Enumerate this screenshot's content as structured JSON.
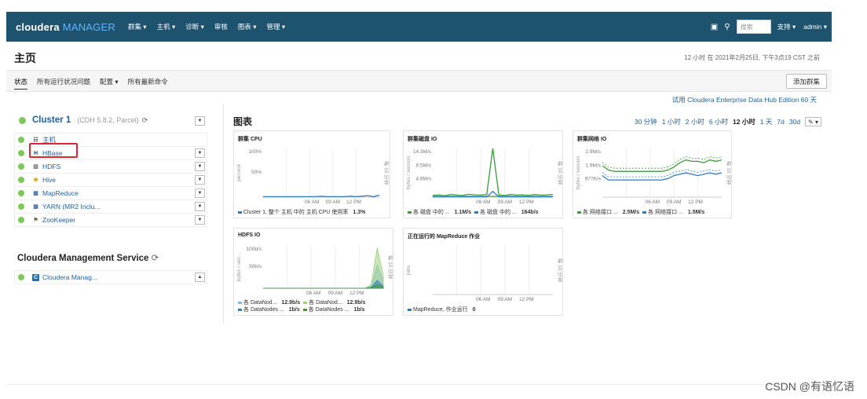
{
  "navbar": {
    "brand_main": "cloudera",
    "brand_sub": "MANAGER",
    "menu": [
      "群集 ▾",
      "主机 ▾",
      "诊断 ▾",
      "审核",
      "图表 ▾",
      "管理 ▾"
    ],
    "icons": [
      "briefcase-icon",
      "search-user-icon"
    ],
    "search_placeholder": "搜索",
    "support": "支持 ▾",
    "user": "admin ▾"
  },
  "page": {
    "title": "主页",
    "timestamp": "12 小时 在 2021年2月25日, 下午3点19 CST 之前"
  },
  "subnav": {
    "tabs": [
      "状态",
      "所有运行状况问题",
      "配置 ▾",
      "所有最新命令"
    ],
    "add_cluster": "添加群集"
  },
  "trial": "试用 Cloudera Enterprise Data Hub Edition 60 天",
  "cluster": {
    "name": "Cluster 1",
    "version": "(CDH 5.8.2, Parcel)",
    "status_color": "#7cc95a",
    "services": [
      {
        "name": "主机",
        "icon": "hosts-icon",
        "dropdown": false
      },
      {
        "name": "HBase",
        "icon": "hbase-icon",
        "dropdown": true
      },
      {
        "name": "HDFS",
        "icon": "hdfs-icon",
        "dropdown": true
      },
      {
        "name": "Hive",
        "icon": "hive-icon",
        "dropdown": true
      },
      {
        "name": "MapReduce",
        "icon": "mapreduce-icon",
        "dropdown": true
      },
      {
        "name": "YARN (MR2 Inclu...",
        "icon": "yarn-icon",
        "dropdown": true
      },
      {
        "name": "ZooKeeper",
        "icon": "zookeeper-icon",
        "dropdown": true
      }
    ]
  },
  "mgmt": {
    "title": "Cloudera Management Service",
    "service": "Cloudera Manag..."
  },
  "charts": {
    "title": "图表",
    "ranges": [
      "30 分钟",
      "1 小时",
      "2 小时",
      "6 小时",
      "12 小时",
      "1 天",
      "7d",
      "30d"
    ],
    "selected_range": "12 小时",
    "edit_icon": "edit-icon"
  },
  "chart_data": [
    {
      "type": "line",
      "title": "群集 CPU",
      "ylabel": "percent",
      "yticks": [
        "100%",
        "50%"
      ],
      "xticks": [
        "06 AM",
        "09 AM",
        "12 PM"
      ],
      "right_label": "每 10 分钟",
      "ylim": [
        0,
        100
      ],
      "series": [
        {
          "name": "Cluster 1, 整个 主机 中的 主机 CPU 使用率",
          "value": "1.3%",
          "color": "#2f7bbf",
          "values": [
            1,
            1,
            1,
            1,
            1,
            1,
            1,
            1,
            1,
            1,
            2,
            1,
            1,
            1,
            1,
            2,
            1,
            2,
            3,
            1,
            4
          ]
        }
      ]
    },
    {
      "type": "line",
      "title": "群集磁盘 IO",
      "ylabel": "bytes / second",
      "yticks": [
        "14.3M/s",
        "9.5M/s",
        "4.8M/s"
      ],
      "xticks": [
        "06 AM",
        "09 AM",
        "12 PM"
      ],
      "right_label": "每 10 分钟",
      "ylim": [
        0,
        17
      ],
      "series": [
        {
          "name": "各 磁盘 中的 ...",
          "value": "1.1M/s",
          "color": "#3a9a3a",
          "values": [
            0.6,
            0.8,
            0.5,
            0.9,
            0.7,
            0.6,
            1.0,
            0.8,
            0.7,
            0.9,
            17,
            0.8,
            0.6,
            0.9,
            0.7,
            0.8,
            0.6,
            0.9,
            0.7,
            0.8,
            1.0
          ]
        },
        {
          "name": "各 磁盘 中的 ...",
          "value": "164b/s",
          "color": "#2f7bbf",
          "values": [
            0.1,
            0.1,
            0.1,
            0.1,
            0.1,
            0.1,
            0.1,
            0.1,
            0.1,
            0.1,
            2,
            0.1,
            0.1,
            0.1,
            0.1,
            0.1,
            0.1,
            0.1,
            0.1,
            0.1,
            0.1
          ]
        }
      ]
    },
    {
      "type": "line",
      "title": "群集网络 IO",
      "ylabel": "bytes / second",
      "yticks": [
        "2.9M/s",
        "1.9M/s",
        "977K/s"
      ],
      "xticks": [
        "06 AM",
        "09 AM",
        "12 PM"
      ],
      "right_label": "每 10 分钟",
      "ylim": [
        0,
        3.4
      ],
      "series": [
        {
          "name": "各 网络接口 ...",
          "value": "2.5M/s",
          "color": "#3a9a3a",
          "values": [
            2.2,
            1.9,
            1.8,
            1.8,
            1.8,
            1.8,
            1.8,
            1.8,
            1.8,
            1.8,
            1.8,
            1.9,
            2.1,
            2.4,
            2.6,
            2.5,
            2.5,
            2.4,
            2.6,
            2.5,
            2.6
          ]
        },
        {
          "name": "各 网络接口 ...",
          "value": "1.5M/s",
          "color": "#2f7bbf",
          "values": [
            1.5,
            1.2,
            1.2,
            1.2,
            1.2,
            1.2,
            1.2,
            1.2,
            1.2,
            1.2,
            1.2,
            1.3,
            1.5,
            1.6,
            1.7,
            1.6,
            1.5,
            1.6,
            1.7,
            1.6,
            1.7
          ]
        }
      ]
    },
    {
      "type": "area",
      "title": "HDFS IO",
      "ylabel": "bytes / sec...",
      "yticks": [
        "100b/s",
        "50b/s"
      ],
      "xticks": [
        "06 AM",
        "09 AM",
        "12 PM"
      ],
      "right_label": "每 10 分钟",
      "ylim": [
        0,
        110
      ],
      "series": [
        {
          "name": "各 DataNod...",
          "value": "12.9b/s",
          "color": "#7fb5e0",
          "values": [
            0,
            0,
            0,
            0,
            0,
            0,
            0,
            0,
            0,
            0,
            0,
            0,
            0,
            0,
            0,
            0,
            0,
            0,
            5,
            60,
            20
          ]
        },
        {
          "name": "各 DataNod...",
          "value": "12.9b/s",
          "color": "#9fd27f",
          "values": [
            0,
            0,
            0,
            0,
            0,
            0,
            0,
            0,
            0,
            0,
            0,
            0,
            0,
            0,
            0,
            0,
            0,
            0,
            10,
            105,
            35
          ]
        },
        {
          "name": "各 DataNodes ...",
          "value": "1b/s",
          "color": "#2f7bbf",
          "values": [
            0,
            0,
            0,
            0,
            0,
            0,
            0,
            0,
            0,
            0,
            0,
            0,
            0,
            0,
            0,
            0,
            0,
            0,
            2,
            20,
            6
          ]
        },
        {
          "name": "各 DataNodes ...",
          "value": "1b/s",
          "color": "#3a9a3a",
          "values": [
            0,
            0,
            0,
            0,
            0,
            0,
            0,
            0,
            0,
            0,
            0,
            0,
            0,
            0,
            0,
            0,
            0,
            0,
            1,
            10,
            3
          ]
        }
      ]
    },
    {
      "type": "line",
      "title": "正在运行的 MapReduce 作业",
      "ylabel": "jobs",
      "yticks": [],
      "xticks": [
        "06 AM",
        "09 AM",
        "12 PM"
      ],
      "right_label": "每 10 分钟",
      "ylim": [
        0,
        1
      ],
      "series": [
        {
          "name": "MapReduce, 作业运行",
          "value": "0",
          "color": "#2f7bbf",
          "values": []
        }
      ]
    }
  ],
  "watermark": "CSDN @有语忆语"
}
